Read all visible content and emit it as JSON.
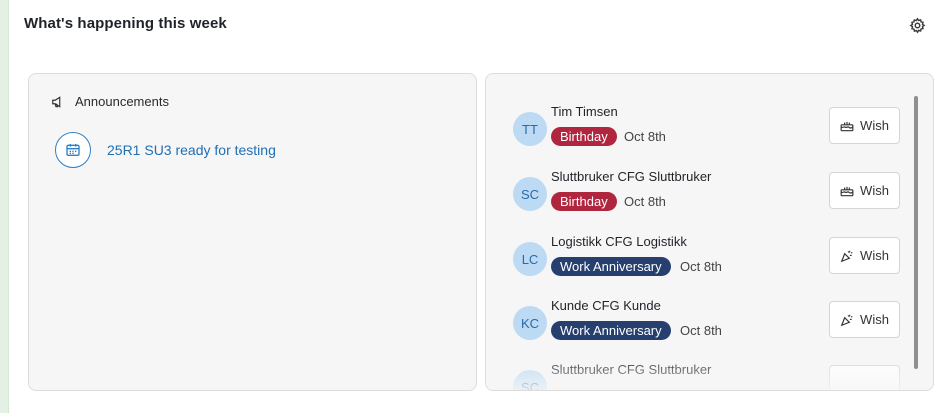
{
  "widget": {
    "title": "What's happening this week",
    "settings_icon": "gear-icon"
  },
  "announcements": {
    "header_icon": "megaphone-icon",
    "header_label": "Announcements",
    "items": [
      {
        "icon": "calendar-icon",
        "title": "25R1 SU3 ready for testing"
      }
    ]
  },
  "events": [
    {
      "initials": "TT",
      "name": "Tim Timsen",
      "type": "Birthday",
      "date": "Oct 8th",
      "wish_label": "Wish",
      "wish_icon": "cake-icon"
    },
    {
      "initials": "SC",
      "name": "Sluttbruker CFG Sluttbruker",
      "type": "Birthday",
      "date": "Oct 8th",
      "wish_label": "Wish",
      "wish_icon": "cake-icon"
    },
    {
      "initials": "LC",
      "name": "Logistikk CFG Logistikk",
      "type": "Work Anniversary",
      "date": "Oct 8th",
      "wish_label": "Wish",
      "wish_icon": "party-popper-icon"
    },
    {
      "initials": "KC",
      "name": "Kunde CFG Kunde",
      "type": "Work Anniversary",
      "date": "Oct 8th",
      "wish_label": "Wish",
      "wish_icon": "party-popper-icon"
    },
    {
      "initials": "SC",
      "name": "Sluttbruker CFG Sluttbruker",
      "type": "",
      "date": "",
      "wish_label": "",
      "wish_icon": ""
    }
  ],
  "colors": {
    "birthday_badge": "#b0263f",
    "anniversary_badge": "#263f6e",
    "link": "#1f6fb5",
    "avatar_bg": "#bcdaf3"
  }
}
